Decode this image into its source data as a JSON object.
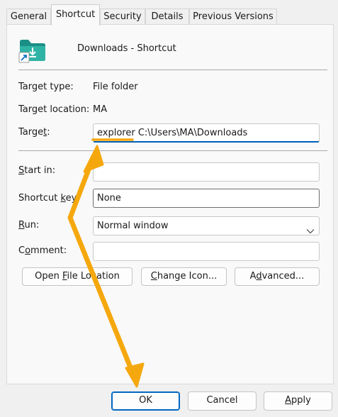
{
  "tabs": [
    {
      "label": "General"
    },
    {
      "label": "Shortcut"
    },
    {
      "label": "Security"
    },
    {
      "label": "Details"
    },
    {
      "label": "Previous Versions"
    }
  ],
  "header": {
    "title": "Downloads - Shortcut",
    "icon": "folder-shortcut-icon"
  },
  "info": {
    "target_type_label": "Target type:",
    "target_type_value": "File folder",
    "target_location_label": "Target location:",
    "target_location_value": "MA"
  },
  "form": {
    "target_label": "Target:",
    "target_value": "explorer C:\\Users\\MA\\Downloads",
    "start_in_label": "Start in:",
    "start_in_value": "",
    "shortcut_key_label": "Shortcut key:",
    "shortcut_key_value": "None",
    "run_label": "Run:",
    "run_value": "Normal window",
    "comment_label": "Comment:",
    "comment_value": ""
  },
  "actions": {
    "open_file_location": "Open File Location",
    "change_icon": "Change Icon...",
    "advanced": "Advanced..."
  },
  "footer": {
    "ok": "OK",
    "cancel": "Cancel",
    "apply": "Apply"
  },
  "colors": {
    "accent": "#005fb8",
    "annotation": "#f5a80e"
  }
}
